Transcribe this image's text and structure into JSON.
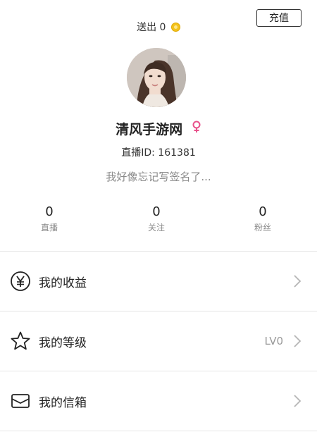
{
  "header": {
    "sent_label": "送出",
    "sent_count": "0",
    "coin_icon": "coin-icon",
    "recharge_label": "充值"
  },
  "profile": {
    "name": "清风手游网",
    "gender_icon": "female-icon",
    "live_id": "直播ID: 161381",
    "signature": "我好像忘记写签名了..."
  },
  "stats": [
    {
      "value": "0",
      "label": "直播"
    },
    {
      "value": "0",
      "label": "关注"
    },
    {
      "value": "0",
      "label": "粉丝"
    }
  ],
  "menu": [
    {
      "label": "我的收益",
      "value": "",
      "icon": "yuan-circle-icon"
    },
    {
      "label": "我的等级",
      "value": "LV0",
      "icon": "star-icon"
    },
    {
      "label": "我的信箱",
      "value": "",
      "icon": "envelope-icon"
    }
  ],
  "colors": {
    "accent_pink": "#e8508a",
    "coin_gold": "#f3c21b"
  }
}
